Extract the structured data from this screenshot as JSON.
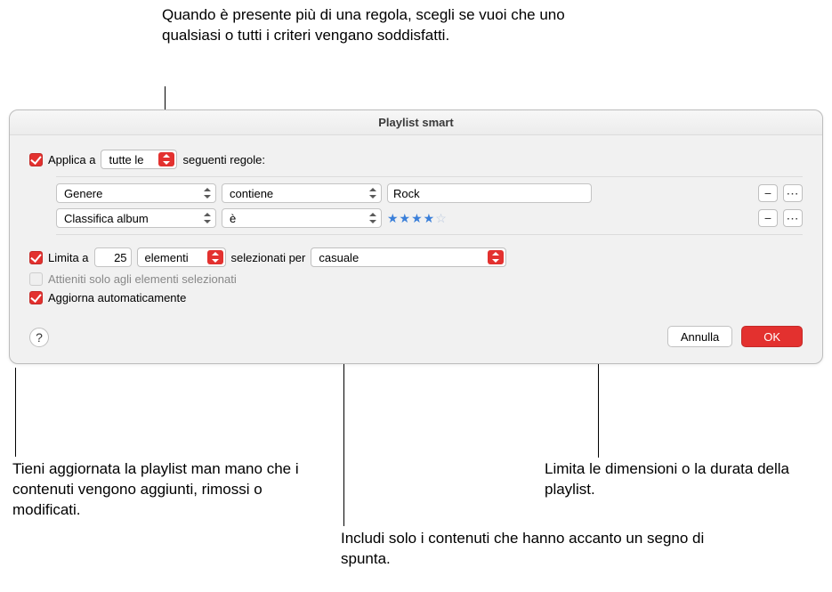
{
  "callouts": {
    "top": "Quando è presente più di una regola, scegli se vuoi che uno qualsiasi o tutti i criteri vengano soddisfatti.",
    "bottom_left": "Tieni aggiornata la playlist man mano che i contenuti vengono aggiunti, rimossi o modificati.",
    "bottom_mid": "Includi solo i contenuti che hanno accanto un segno di spunta.",
    "bottom_right": "Limita le dimensioni o la durata della playlist."
  },
  "window": {
    "title": "Playlist smart",
    "match_prefix": "Applica a",
    "match_select": "tutte le",
    "match_suffix": "seguenti regole:",
    "rules": [
      {
        "field": "Genere",
        "op": "contiene",
        "value": "Rock",
        "stars": null
      },
      {
        "field": "Classifica album",
        "op": "è",
        "value": null,
        "stars": 4
      }
    ],
    "limit_prefix": "Limita a",
    "limit_value": "25",
    "limit_unit": "elementi",
    "limit_mid": "selezionati per",
    "limit_method": "casuale",
    "only_checked": "Attieniti solo agli elementi selezionati",
    "live_update": "Aggiorna automaticamente",
    "cancel": "Annulla",
    "ok": "OK",
    "help": "?"
  }
}
